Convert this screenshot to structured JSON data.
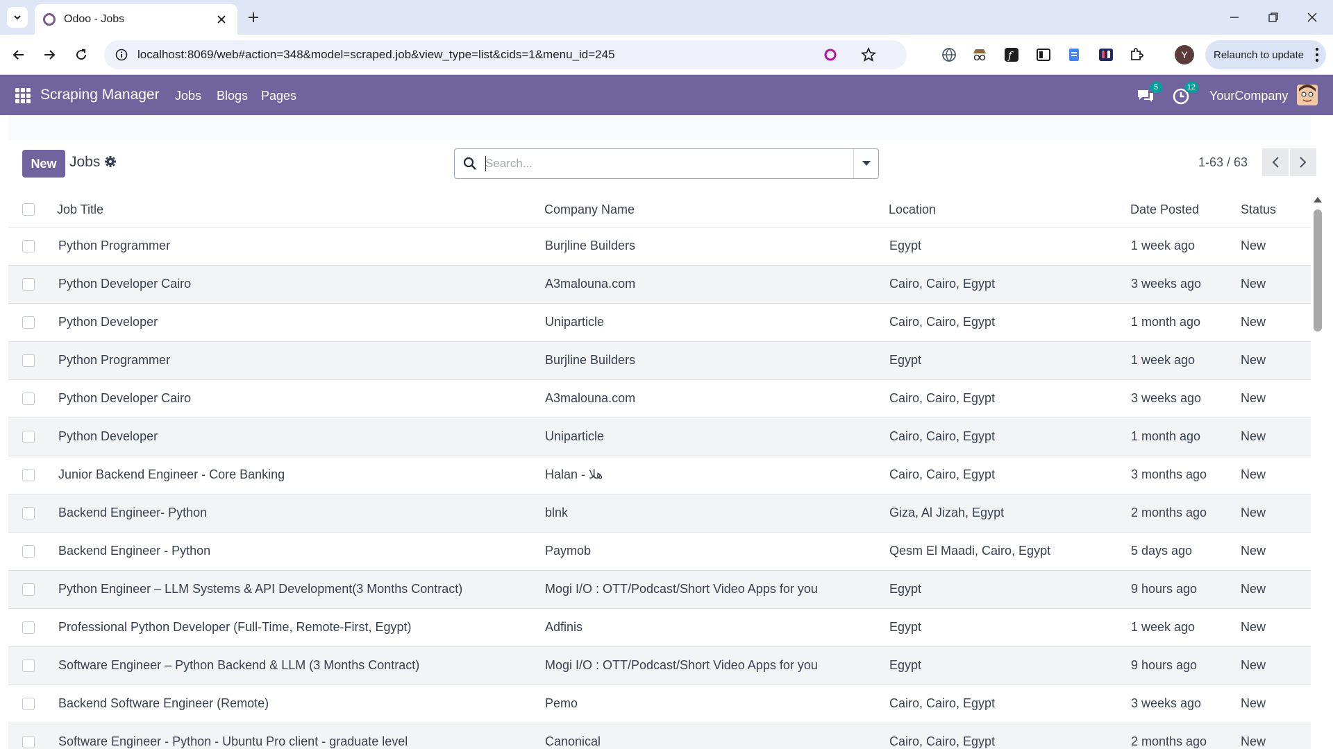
{
  "browser": {
    "tab_title": "Odoo - Jobs",
    "url": "localhost:8069/web#action=348&model=scraped.job&view_type=list&cids=1&menu_id=245",
    "profile_initial": "Y",
    "relaunch_label": "Relaunch to update"
  },
  "navbar": {
    "app_name": "Scraping Manager",
    "menu": [
      "Jobs",
      "Blogs",
      "Pages"
    ],
    "messages_count": "5",
    "activities_count": "12",
    "company": "YourCompany"
  },
  "control_panel": {
    "new_label": "New",
    "view_title": "Jobs",
    "search_placeholder": "Search...",
    "pager_value": "1-63 / 63"
  },
  "colors": {
    "brand": "#71639e",
    "badge": "#00a09d"
  },
  "table": {
    "columns": [
      "Job Title",
      "Company Name",
      "Location",
      "Date Posted",
      "Status"
    ],
    "rows": [
      {
        "title": "Python Programmer",
        "company": "Burjline Builders",
        "location": "Egypt",
        "date": "1 week ago",
        "status": "New"
      },
      {
        "title": "Python Developer Cairo",
        "company": "A3malouna.com",
        "location": "Cairo, Cairo, Egypt",
        "date": "3 weeks ago",
        "status": "New"
      },
      {
        "title": "Python Developer",
        "company": "Uniparticle",
        "location": "Cairo, Cairo, Egypt",
        "date": "1 month ago",
        "status": "New"
      },
      {
        "title": "Python Programmer",
        "company": "Burjline Builders",
        "location": "Egypt",
        "date": "1 week ago",
        "status": "New"
      },
      {
        "title": "Python Developer Cairo",
        "company": "A3malouna.com",
        "location": "Cairo, Cairo, Egypt",
        "date": "3 weeks ago",
        "status": "New"
      },
      {
        "title": "Python Developer",
        "company": "Uniparticle",
        "location": "Cairo, Cairo, Egypt",
        "date": "1 month ago",
        "status": "New"
      },
      {
        "title": "Junior Backend Engineer - Core Banking",
        "company": "Halan - هلا",
        "location": "Cairo, Cairo, Egypt",
        "date": "3 months ago",
        "status": "New"
      },
      {
        "title": "Backend Engineer- Python",
        "company": "blnk",
        "location": "Giza, Al Jizah, Egypt",
        "date": "2 months ago",
        "status": "New"
      },
      {
        "title": "Backend Engineer - Python",
        "company": "Paymob",
        "location": "Qesm El Maadi, Cairo, Egypt",
        "date": "5 days ago",
        "status": "New"
      },
      {
        "title": "Python Engineer – LLM Systems & API Development(3 Months Contract)",
        "company": "Mogi I/O : OTT/Podcast/Short Video Apps for you",
        "location": "Egypt",
        "date": "9 hours ago",
        "status": "New"
      },
      {
        "title": "Professional Python Developer (Full-Time, Remote-First, Egypt)",
        "company": "Adfinis",
        "location": "Egypt",
        "date": "1 week ago",
        "status": "New"
      },
      {
        "title": "Software Engineer – Python Backend & LLM (3 Months Contract)",
        "company": "Mogi I/O : OTT/Podcast/Short Video Apps for you",
        "location": "Egypt",
        "date": "9 hours ago",
        "status": "New"
      },
      {
        "title": "Backend Software Engineer (Remote)",
        "company": "Pemo",
        "location": "Cairo, Cairo, Egypt",
        "date": "3 weeks ago",
        "status": "New"
      },
      {
        "title": "Software Engineer - Python - Ubuntu Pro client - graduate level",
        "company": "Canonical",
        "location": "Cairo, Cairo, Egypt",
        "date": "2 months ago",
        "status": "New"
      }
    ]
  }
}
